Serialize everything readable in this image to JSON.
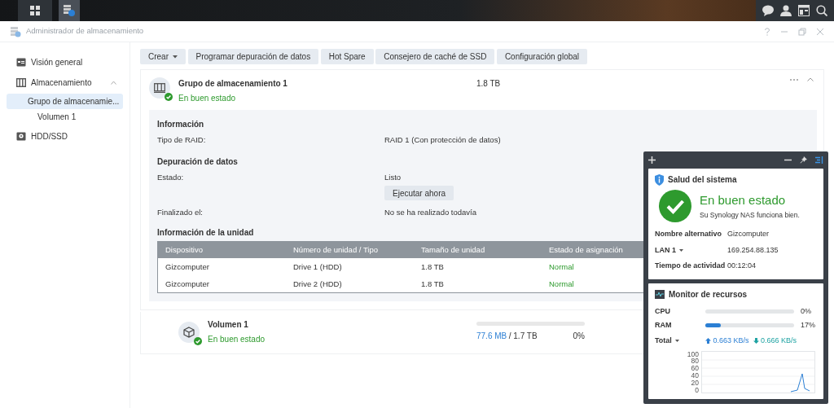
{
  "window": {
    "title": "Administrador de almacenamiento"
  },
  "sidebar": {
    "items": [
      {
        "label": "Visión general",
        "kind": "overview",
        "selected": false
      },
      {
        "label": "Almacenamiento",
        "kind": "storage",
        "selected": false,
        "expanded": true,
        "children": [
          {
            "label": "Grupo de almacenamie...",
            "selected": true,
            "children": [
              {
                "label": "Volumen 1",
                "selected": false
              }
            ]
          }
        ]
      },
      {
        "label": "HDD/SSD",
        "kind": "drive",
        "selected": false
      }
    ]
  },
  "toolbar": [
    {
      "label": "Crear",
      "dropdown": true
    },
    {
      "label": "Programar depuración de datos",
      "dropdown": false
    },
    {
      "label": "Hot Spare",
      "dropdown": false
    },
    {
      "label": "Consejero de caché de SSD",
      "dropdown": false
    },
    {
      "label": "Configuración global",
      "dropdown": false
    }
  ],
  "pool": {
    "title": "Grupo de almacenamiento 1",
    "status": "En buen estado",
    "size": "1.8 TB",
    "expanded": true,
    "sections": [
      {
        "heading": "Información",
        "rows": [
          {
            "label": "Tipo de RAID:",
            "value": "RAID 1 (Con protección de datos)"
          }
        ]
      },
      {
        "heading": "Depuración de datos",
        "rows": [
          {
            "label": "Estado:",
            "value": "Listo",
            "action": "Ejecutar ahora"
          },
          {
            "label": "Finalizado el:",
            "value": "No se ha realizado todavía"
          }
        ]
      }
    ],
    "drives": {
      "heading": "Información de la unidad",
      "columns": [
        "Dispositivo",
        "Número de unidad / Tipo",
        "Tamaño de unidad",
        "Estado de asignación"
      ],
      "rows": [
        [
          "Gizcomputer",
          "Drive 1 (HDD)",
          "1.8 TB",
          "Normal"
        ],
        [
          "Gizcomputer",
          "Drive 2 (HDD)",
          "1.8 TB",
          "Normal"
        ]
      ]
    }
  },
  "volume": {
    "title": "Volumen 1",
    "status": "En buen estado",
    "level": 0,
    "used": "77.6 MB",
    "total": "/ 1.7 TB",
    "percent": "0%"
  },
  "widgets": {
    "health": {
      "title": "Salud del sistema",
      "status": "En buen estado",
      "message": "Su Synology NAS funciona bien.",
      "rows": [
        {
          "label": "Nombre alternativo",
          "value": "Gizcomputer",
          "dropdown": false
        },
        {
          "label": "LAN 1",
          "value": "169.254.88.135",
          "dropdown": true
        },
        {
          "label": "Tiempo de actividad",
          "value": "00:12:04",
          "dropdown": false
        }
      ]
    },
    "monitor": {
      "title": "Monitor de recursos",
      "meters": [
        {
          "label": "CPU",
          "level": 0,
          "reading": "0%"
        },
        {
          "label": "RAM",
          "level": 0.17,
          "reading": "17%"
        }
      ],
      "total": {
        "label": "Total",
        "upload": "0.663 KB/s",
        "download": "0.666 KB/s"
      },
      "chart_ticks": [
        "100",
        "80",
        "60",
        "40",
        "20",
        "0"
      ]
    }
  }
}
